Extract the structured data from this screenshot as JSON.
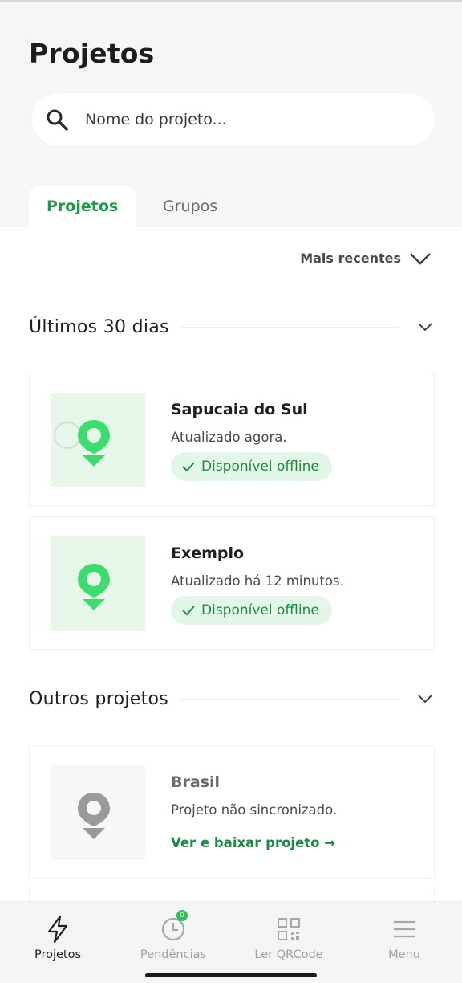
{
  "header": {
    "title": "Projetos",
    "search_placeholder": "Nome do projeto..."
  },
  "tabs": [
    {
      "label": "Projetos",
      "active": true
    },
    {
      "label": "Grupos",
      "active": false
    }
  ],
  "sort": {
    "label": "Mais recentes"
  },
  "sections": [
    {
      "title": "Últimos 30 dias",
      "projects": [
        {
          "name": "Sapucaia do Sul",
          "status": "Atualizado agora.",
          "badge": "Disponível offline"
        },
        {
          "name": "Exemplo",
          "status": "Atualizado há 12 minutos.",
          "badge": "Disponível offline"
        }
      ]
    },
    {
      "title": "Outros projetos",
      "projects": [
        {
          "name": "Brasil",
          "status": "Projeto não sincronizado.",
          "link": "Ver e baixar projeto →"
        }
      ]
    }
  ],
  "bottom_nav": [
    {
      "label": "Projetos",
      "icon": "lightning-icon",
      "active": true
    },
    {
      "label": "Pendências",
      "icon": "clock-icon",
      "active": false,
      "badge": "0"
    },
    {
      "label": "Ler QRCode",
      "icon": "qrcode-icon",
      "active": false
    },
    {
      "label": "Menu",
      "icon": "hamburger-menu-icon",
      "active": false
    }
  ],
  "colors": {
    "accent": "#1f9a4a",
    "badge_bg": "#e3f7e8",
    "pin_green": "#3ddc6e",
    "pin_grey": "#9a9a9a"
  }
}
